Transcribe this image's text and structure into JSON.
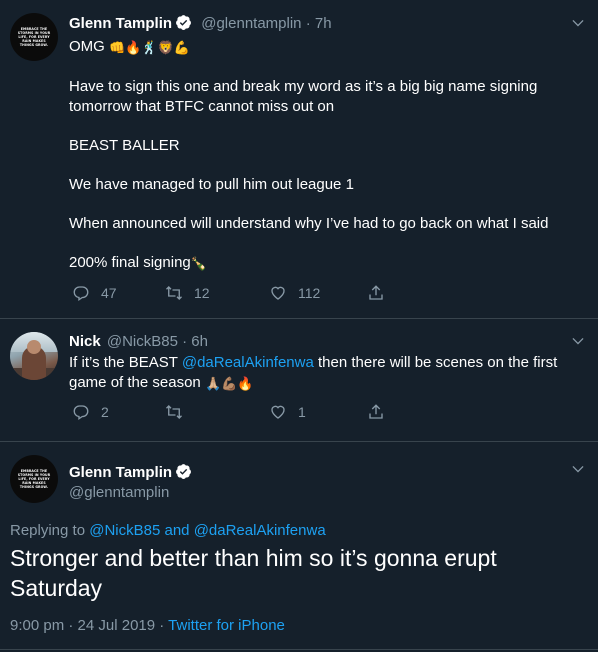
{
  "tweet1": {
    "name": "Glenn Tamplin",
    "handle": "@glenntamplin",
    "time": "7h",
    "avatar_text": "EMBRACE THE STORMS IN YOUR LIFE, FOR EVERY RAIN MAKES THINGS GROW.",
    "line1": "OMG",
    "line1_emoji": "👊🔥🕺🦁💪",
    "paragraphs": [
      "Have to sign this one and break my word as it’s a big big name  signing tomorrow that BTFC cannot miss out on",
      "BEAST BALLER",
      "We have managed to pull him out league 1",
      "When announced will understand why I’ve had to go back on what I said"
    ],
    "last_line": "200% final signing",
    "last_emoji": "🍾",
    "reply_count": "47",
    "retweet_count": "12",
    "like_count": "112"
  },
  "tweet2": {
    "name": "Nick",
    "handle": "@NickB85",
    "time": "6h",
    "text_before": "If it’s the BEAST ",
    "mention": "@daRealAkinfenwa",
    "text_after": " then there will be scenes on the first game of the season ",
    "emoji": "🙏🏼💪🏽🔥",
    "reply_count": "2",
    "retweet_count": "",
    "like_count": "1"
  },
  "main": {
    "name": "Glenn Tamplin",
    "handle": "@glenntamplin",
    "replying_prefix": "Replying to ",
    "reply_to_1": "@NickB85",
    "replying_and": " and ",
    "reply_to_2": "@daRealAkinfenwa",
    "text": "Stronger and better than him so it’s gonna erupt Saturday",
    "time": "9:00 pm · 24 Jul 2019 · ",
    "source": "Twitter for iPhone"
  },
  "colors": {
    "background": "#15202b",
    "muted": "#8899a6",
    "link": "#1da1f2",
    "divider": "#38444d"
  }
}
